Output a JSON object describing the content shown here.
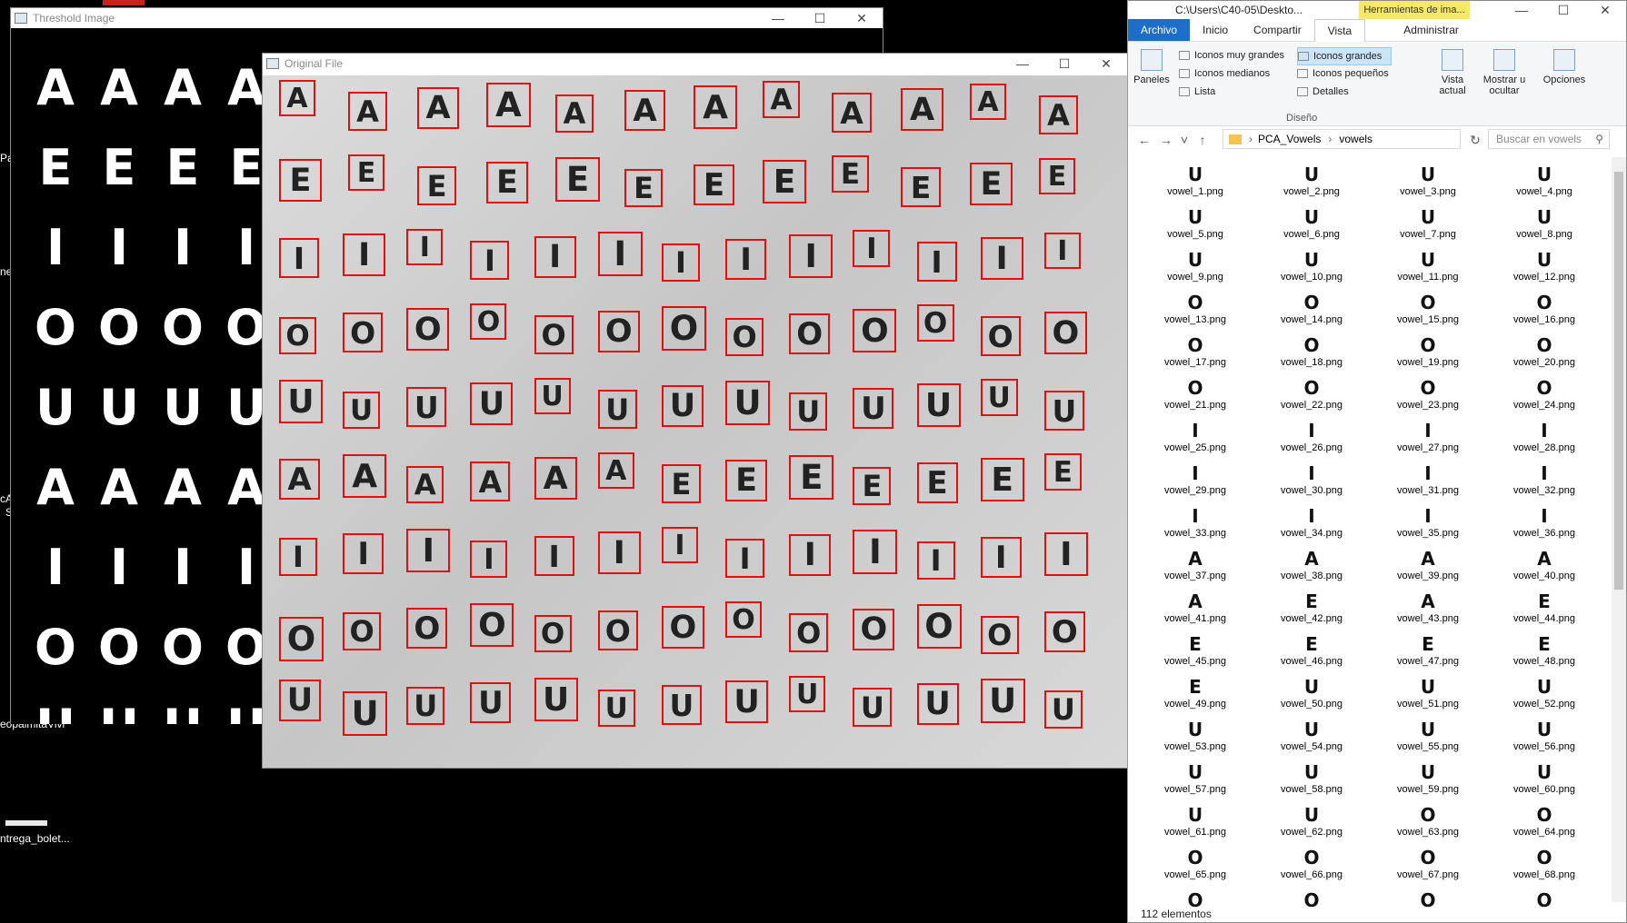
{
  "desktop": {
    "labels": [
      {
        "text": "Pa"
      },
      {
        "text": "ne"
      },
      {
        "text": "cA"
      },
      {
        "text": "S"
      },
      {
        "text": "eopalmitaVivi"
      },
      {
        "text": "ntrega_bolet..."
      }
    ]
  },
  "threshold_window": {
    "title": "Threshold Image",
    "rows": [
      [
        "A",
        "A",
        "A",
        "A"
      ],
      [
        "E",
        "E",
        "E",
        "E"
      ],
      [
        "I",
        "I",
        "I",
        "I"
      ],
      [
        "O",
        "O",
        "O",
        "O"
      ],
      [
        "U",
        "U",
        "U",
        "U"
      ],
      [
        "A",
        "A",
        "A",
        "A"
      ],
      [
        "I",
        "I",
        "I",
        "I"
      ],
      [
        "O",
        "O",
        "O",
        "O"
      ],
      [
        "U",
        "U",
        "U",
        "U"
      ]
    ]
  },
  "original_window": {
    "title": "Original File",
    "rows": [
      [
        "A",
        "A",
        "A",
        "A",
        "A",
        "A",
        "A",
        "A",
        "A",
        "A",
        "A",
        "A"
      ],
      [
        "E",
        "E",
        "E",
        "E",
        "E",
        "E",
        "E",
        "E",
        "E",
        "E",
        "E",
        "E"
      ],
      [
        "I",
        "I",
        "I",
        "I",
        "I",
        "I",
        "I",
        "I",
        "I",
        "I",
        "I",
        "I",
        "I"
      ],
      [
        "O",
        "O",
        "O",
        "O",
        "O",
        "O",
        "O",
        "O",
        "O",
        "O",
        "O",
        "O",
        "O"
      ],
      [
        "U",
        "U",
        "U",
        "U",
        "U",
        "U",
        "U",
        "U",
        "U",
        "U",
        "U",
        "U",
        "U"
      ],
      [
        "A",
        "A",
        "A",
        "A",
        "A",
        "A",
        "E",
        "E",
        "E",
        "E",
        "E",
        "E",
        "E"
      ],
      [
        "I",
        "I",
        "I",
        "I",
        "I",
        "I",
        "I",
        "I",
        "I",
        "I",
        "I",
        "I",
        "I"
      ],
      [
        "O",
        "O",
        "O",
        "O",
        "O",
        "O",
        "O",
        "O",
        "O",
        "O",
        "O",
        "O",
        "O"
      ],
      [
        "U",
        "U",
        "U",
        "U",
        "U",
        "U",
        "U",
        "U",
        "U",
        "U",
        "U",
        "U",
        "U"
      ]
    ]
  },
  "explorer": {
    "path_title": "C:\\Users\\C40-05\\Deskto...",
    "tools_tab": "Herramientas de ima...",
    "tabs": [
      "Archivo",
      "Inicio",
      "Compartir",
      "Vista",
      "Administrar"
    ],
    "ribbon": {
      "paneles": "Paneles",
      "layouts": [
        "Iconos muy grandes",
        "Iconos grandes",
        "Iconos medianos",
        "Iconos pequeños",
        "Lista",
        "Detalles"
      ],
      "selected_layout": "Iconos grandes",
      "group_label": "Diseño",
      "vista_actual": "Vista actual",
      "mostrar_ocultar": "Mostrar u ocultar",
      "opciones": "Opciones"
    },
    "breadcrumb": [
      "PCA_Vowels",
      "vowels"
    ],
    "search_placeholder": "Buscar en vowels",
    "files": [
      {
        "name": "vowel_1.png",
        "g": "U"
      },
      {
        "name": "vowel_2.png",
        "g": "U"
      },
      {
        "name": "vowel_3.png",
        "g": "U"
      },
      {
        "name": "vowel_4.png",
        "g": "U"
      },
      {
        "name": "vowel_5.png",
        "g": "U"
      },
      {
        "name": "vowel_6.png",
        "g": "U"
      },
      {
        "name": "vowel_7.png",
        "g": "U"
      },
      {
        "name": "vowel_8.png",
        "g": "U"
      },
      {
        "name": "vowel_9.png",
        "g": "U"
      },
      {
        "name": "vowel_10.png",
        "g": "U"
      },
      {
        "name": "vowel_11.png",
        "g": "U"
      },
      {
        "name": "vowel_12.png",
        "g": "U"
      },
      {
        "name": "vowel_13.png",
        "g": "O"
      },
      {
        "name": "vowel_14.png",
        "g": "O"
      },
      {
        "name": "vowel_15.png",
        "g": "O"
      },
      {
        "name": "vowel_16.png",
        "g": "O"
      },
      {
        "name": "vowel_17.png",
        "g": "O"
      },
      {
        "name": "vowel_18.png",
        "g": "O"
      },
      {
        "name": "vowel_19.png",
        "g": "O"
      },
      {
        "name": "vowel_20.png",
        "g": "O"
      },
      {
        "name": "vowel_21.png",
        "g": "O"
      },
      {
        "name": "vowel_22.png",
        "g": "O"
      },
      {
        "name": "vowel_23.png",
        "g": "O"
      },
      {
        "name": "vowel_24.png",
        "g": "O"
      },
      {
        "name": "vowel_25.png",
        "g": "I"
      },
      {
        "name": "vowel_26.png",
        "g": "I"
      },
      {
        "name": "vowel_27.png",
        "g": "I"
      },
      {
        "name": "vowel_28.png",
        "g": "I"
      },
      {
        "name": "vowel_29.png",
        "g": "I"
      },
      {
        "name": "vowel_30.png",
        "g": "I"
      },
      {
        "name": "vowel_31.png",
        "g": "I"
      },
      {
        "name": "vowel_32.png",
        "g": "I"
      },
      {
        "name": "vowel_33.png",
        "g": "I"
      },
      {
        "name": "vowel_34.png",
        "g": "I"
      },
      {
        "name": "vowel_35.png",
        "g": "I"
      },
      {
        "name": "vowel_36.png",
        "g": "I"
      },
      {
        "name": "vowel_37.png",
        "g": "A"
      },
      {
        "name": "vowel_38.png",
        "g": "A"
      },
      {
        "name": "vowel_39.png",
        "g": "A"
      },
      {
        "name": "vowel_40.png",
        "g": "A"
      },
      {
        "name": "vowel_41.png",
        "g": "A"
      },
      {
        "name": "vowel_42.png",
        "g": "E"
      },
      {
        "name": "vowel_43.png",
        "g": "A"
      },
      {
        "name": "vowel_44.png",
        "g": "E"
      },
      {
        "name": "vowel_45.png",
        "g": "E"
      },
      {
        "name": "vowel_46.png",
        "g": "E"
      },
      {
        "name": "vowel_47.png",
        "g": "E"
      },
      {
        "name": "vowel_48.png",
        "g": "E"
      },
      {
        "name": "vowel_49.png",
        "g": "E"
      },
      {
        "name": "vowel_50.png",
        "g": "U"
      },
      {
        "name": "vowel_51.png",
        "g": "U"
      },
      {
        "name": "vowel_52.png",
        "g": "U"
      },
      {
        "name": "vowel_53.png",
        "g": "U"
      },
      {
        "name": "vowel_54.png",
        "g": "U"
      },
      {
        "name": "vowel_55.png",
        "g": "U"
      },
      {
        "name": "vowel_56.png",
        "g": "U"
      },
      {
        "name": "vowel_57.png",
        "g": "U"
      },
      {
        "name": "vowel_58.png",
        "g": "U"
      },
      {
        "name": "vowel_59.png",
        "g": "U"
      },
      {
        "name": "vowel_60.png",
        "g": "U"
      },
      {
        "name": "vowel_61.png",
        "g": "U"
      },
      {
        "name": "vowel_62.png",
        "g": "U"
      },
      {
        "name": "vowel_63.png",
        "g": "O"
      },
      {
        "name": "vowel_64.png",
        "g": "O"
      },
      {
        "name": "vowel_65.png",
        "g": "O"
      },
      {
        "name": "vowel_66.png",
        "g": "O"
      },
      {
        "name": "vowel_67.png",
        "g": "O"
      },
      {
        "name": "vowel_68.png",
        "g": "O"
      },
      {
        "name": "",
        "g": "O"
      },
      {
        "name": "",
        "g": "O"
      },
      {
        "name": "",
        "g": "O"
      },
      {
        "name": "",
        "g": "O"
      }
    ],
    "status": "112 elementos",
    "colors": {
      "accent": "#1c6ec8",
      "tools_tab": "#f6e96a",
      "box": "#e01010"
    }
  }
}
